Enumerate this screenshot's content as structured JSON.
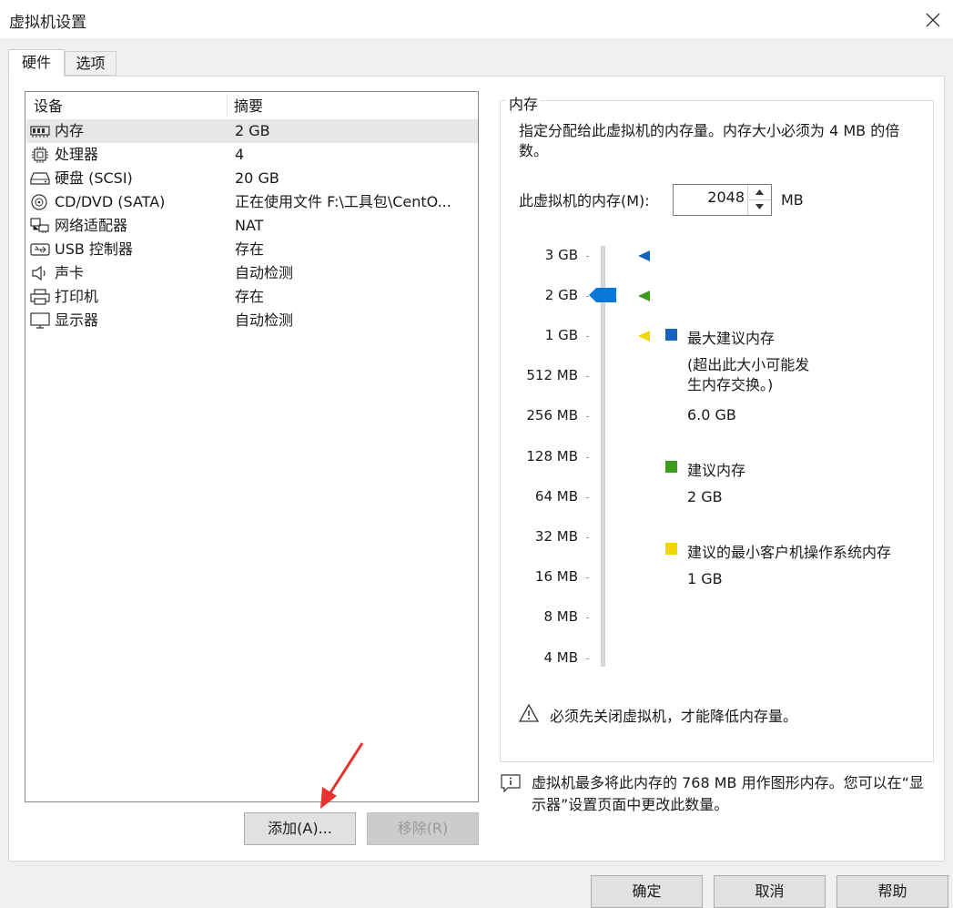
{
  "window": {
    "title": "虚拟机设置"
  },
  "tabs": [
    {
      "label": "硬件"
    },
    {
      "label": "选项"
    }
  ],
  "device_list": {
    "headers": {
      "device": "设备",
      "summary": "摘要"
    },
    "rows": [
      {
        "icon": "memory-icon",
        "name": "内存",
        "summary": "2 GB"
      },
      {
        "icon": "processor-icon",
        "name": "处理器",
        "summary": "4"
      },
      {
        "icon": "hard-disk-icon",
        "name": "硬盘 (SCSI)",
        "summary": "20 GB"
      },
      {
        "icon": "cd-dvd-icon",
        "name": "CD/DVD (SATA)",
        "summary": "正在使用文件 F:\\工具包\\CentO..."
      },
      {
        "icon": "network-adapter-icon",
        "name": "网络适配器",
        "summary": "NAT"
      },
      {
        "icon": "usb-icon",
        "name": "USB 控制器",
        "summary": "存在"
      },
      {
        "icon": "sound-card-icon",
        "name": "声卡",
        "summary": "自动检测"
      },
      {
        "icon": "printer-icon",
        "name": "打印机",
        "summary": "存在"
      },
      {
        "icon": "display-icon",
        "name": "显示器",
        "summary": "自动检测"
      }
    ]
  },
  "buttons": {
    "add": "添加(A)...",
    "remove": "移除(R)",
    "ok": "确定",
    "cancel": "取消",
    "help": "帮助"
  },
  "memory": {
    "group_title": "内存",
    "description": "指定分配给此虚拟机的内存量。内存大小必须为 4 MB 的倍数。",
    "field_label": "此虚拟机的内存(M):",
    "value": "2048",
    "unit": "MB",
    "ticks": [
      "3 GB",
      "2 GB",
      "1 GB",
      "512 MB",
      "256 MB",
      "128 MB",
      "64 MB",
      "32 MB",
      "16 MB",
      "8 MB",
      "4 MB"
    ],
    "legend": {
      "max": {
        "title": "最大建议内存",
        "note": "(超出此大小可能发生内存交换。)",
        "value": "6.0 GB",
        "color": "#1565c0"
      },
      "recommended": {
        "title": "建议内存",
        "value": "2 GB",
        "color": "#3c9a1c"
      },
      "min": {
        "title": "建议的最小客户机操作系统内存",
        "value": "1 GB",
        "color": "#f2d600"
      }
    },
    "warning": "必须先关闭虚拟机，才能降低内存量。",
    "info": "虚拟机最多将此内存的 768 MB 用作图形内存。您可以在“显示器”设置页面中更改此数量。"
  }
}
